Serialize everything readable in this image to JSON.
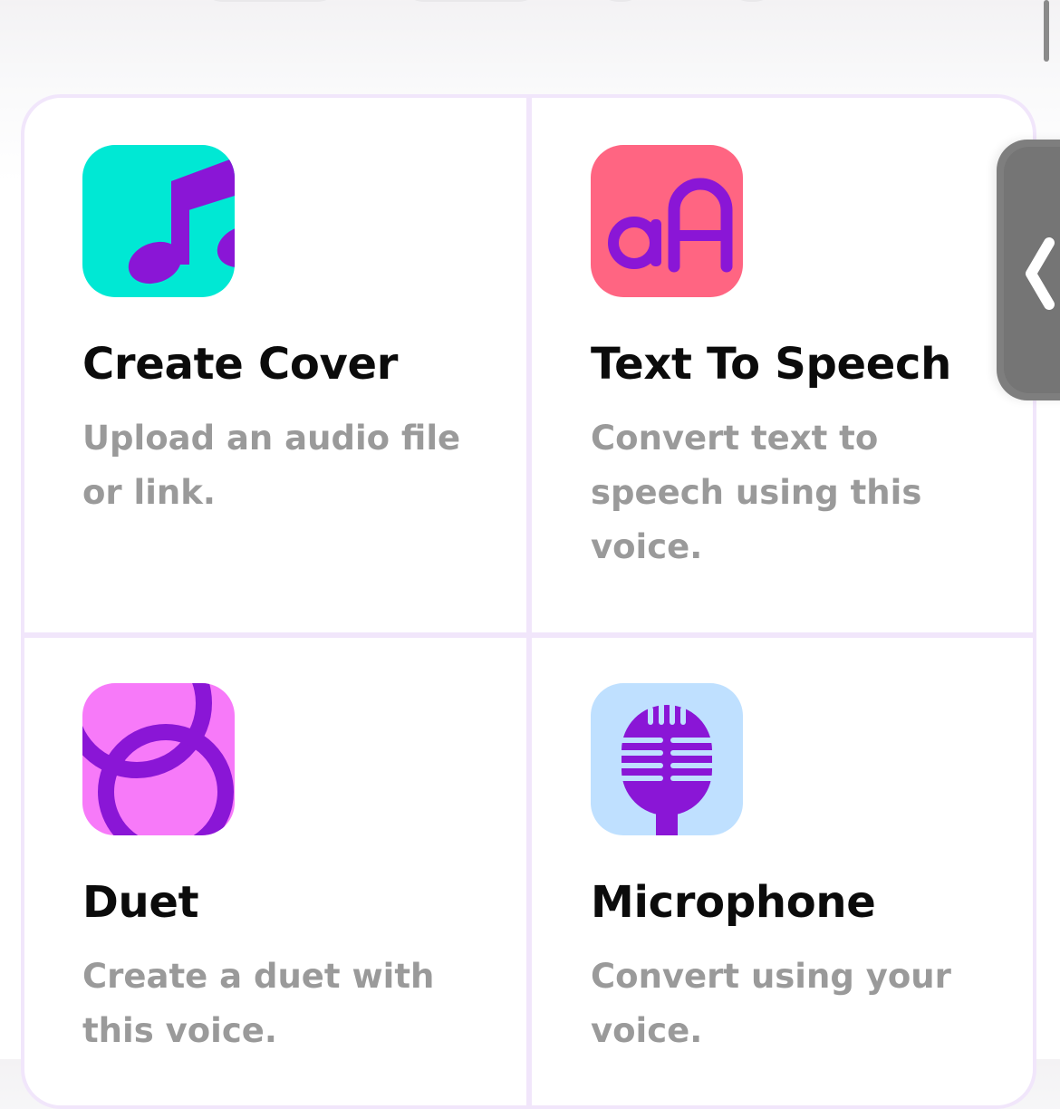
{
  "colors": {
    "accent_purple": "#8a16d6",
    "cover_icon_bg": "#00e8d4",
    "tts_icon_bg": "#ff6582",
    "duet_icon_bg": "#f77af9",
    "mic_icon_bg": "#bfe0ff",
    "title_text": "#0b0b0b",
    "desc_text": "#9a9a9a",
    "card_border": "#f1e6fb",
    "side_tab": "#7e7e7e"
  },
  "actions": [
    {
      "icon": "music-note-icon",
      "title": "Create Cover",
      "description": "Upload an audio file or link."
    },
    {
      "icon": "text-aa-icon",
      "title": "Text To Speech",
      "description": "Convert text to speech using this voice."
    },
    {
      "icon": "duet-loops-icon",
      "title": "Duet",
      "description": "Create a duet with this voice."
    },
    {
      "icon": "microphone-icon",
      "title": "Microphone",
      "description": "Convert using your voice."
    }
  ],
  "side_tab": {
    "icon": "chevron-left-icon"
  }
}
